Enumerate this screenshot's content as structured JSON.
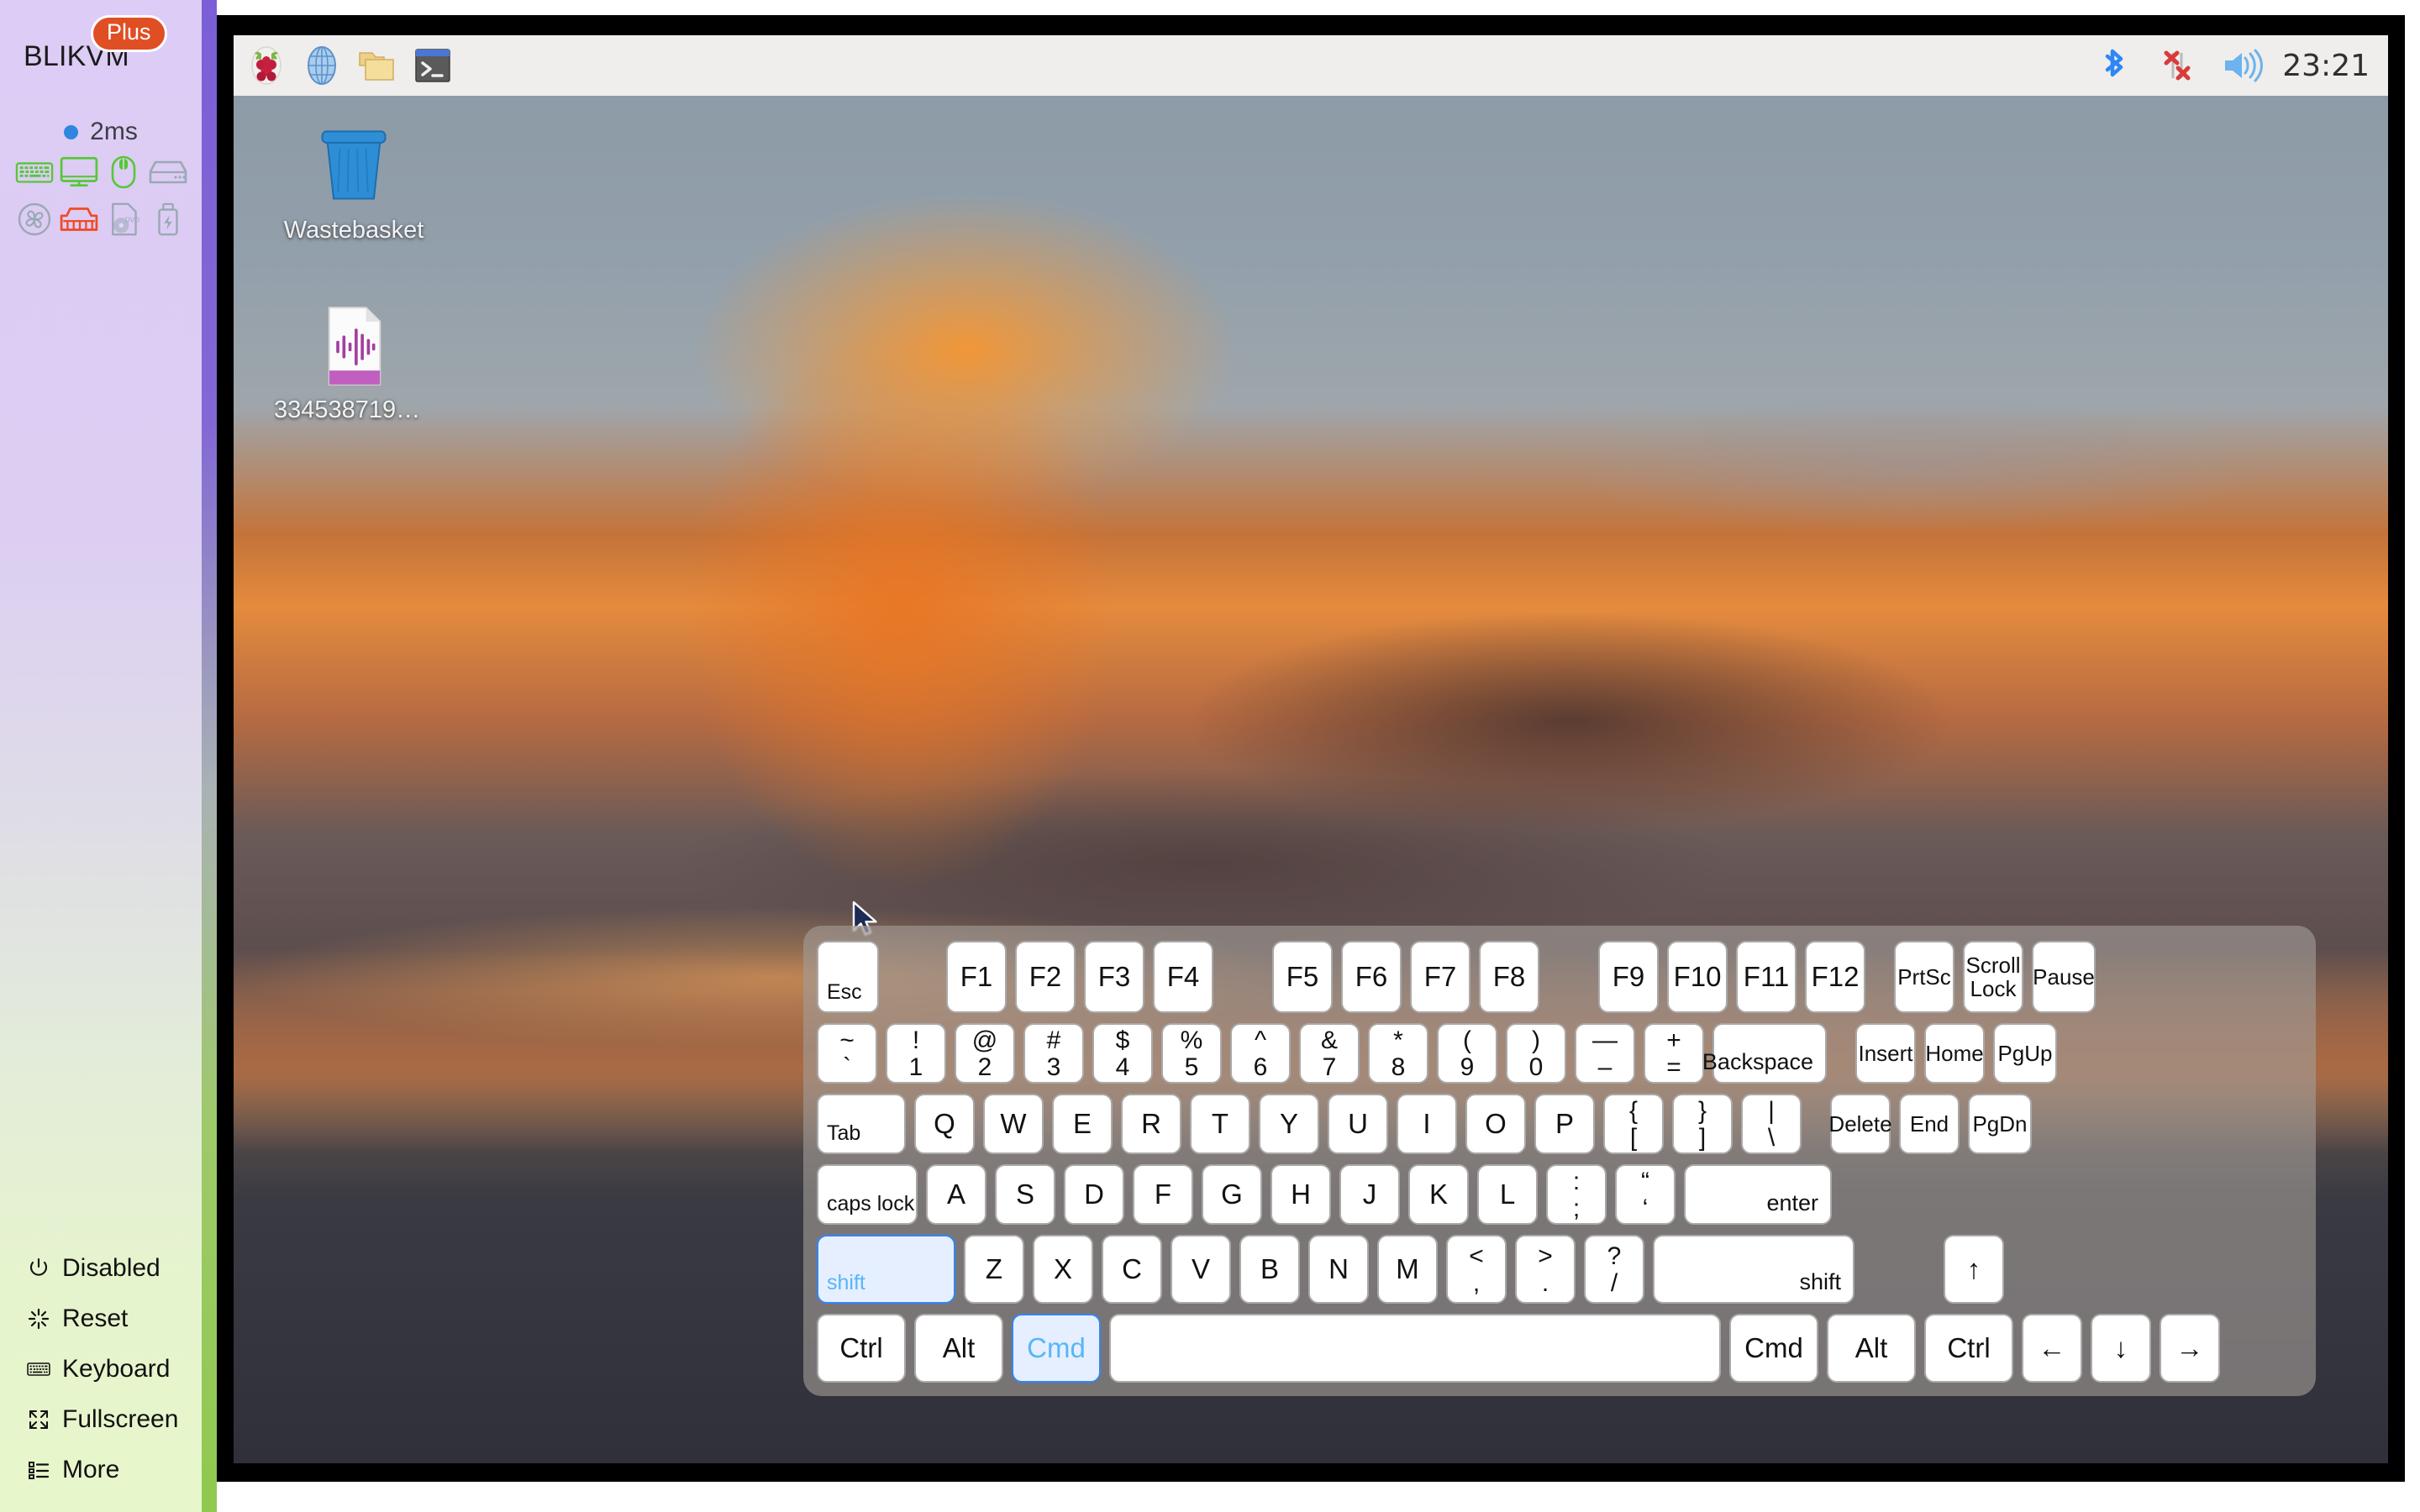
{
  "sidebar": {
    "brand": "BLIKVM",
    "badge": "Plus",
    "latency": "2ms",
    "devices": [
      {
        "name": "keyboard-status-icon",
        "state": "active",
        "color": "#56c736"
      },
      {
        "name": "display-status-icon",
        "state": "active",
        "color": "#56c736"
      },
      {
        "name": "mouse-status-icon",
        "state": "active",
        "color": "#56c736"
      },
      {
        "name": "storage-status-icon",
        "state": "inactive",
        "color": "#9aa9b4"
      },
      {
        "name": "fan-status-icon",
        "state": "inactive",
        "color": "#9aa9b4"
      },
      {
        "name": "ethernet-status-icon",
        "state": "alert",
        "color": "#f04a22"
      },
      {
        "name": "dvd-status-icon",
        "state": "inactive",
        "color": "#9aa9b4"
      },
      {
        "name": "usb-status-icon",
        "state": "inactive",
        "color": "#9aa9b4"
      }
    ],
    "menu": [
      {
        "icon": "power-icon",
        "label": "Disabled"
      },
      {
        "icon": "reset-icon",
        "label": "Reset"
      },
      {
        "icon": "keyboard-icon",
        "label": "Keyboard"
      },
      {
        "icon": "fullscreen-icon",
        "label": "Fullscreen"
      },
      {
        "icon": "more-icon",
        "label": "More"
      }
    ]
  },
  "remote": {
    "taskbar": {
      "launchers": [
        "raspberry-menu-icon",
        "web-browser-icon",
        "file-manager-icon",
        "terminal-icon"
      ],
      "tray": [
        "bluetooth-icon",
        "network-disconnected-icon",
        "volume-icon"
      ],
      "clock": "23:21"
    },
    "desktop_icons": [
      {
        "icon": "wastebasket-icon",
        "label": "Wastebasket"
      },
      {
        "icon": "audio-file-icon",
        "label": "3345387197...."
      }
    ]
  },
  "keyboard": {
    "rows": [
      {
        "id": "function-row",
        "keys": [
          {
            "n": "key-esc",
            "label": "Esc",
            "style": "label-bl",
            "w": "w-esc"
          },
          {
            "n": "gap",
            "type": "gap",
            "px": 60
          },
          {
            "n": "key-f1",
            "label": "F1"
          },
          {
            "n": "key-f2",
            "label": "F2"
          },
          {
            "n": "key-f3",
            "label": "F3"
          },
          {
            "n": "key-f4",
            "label": "F4"
          },
          {
            "n": "gap",
            "type": "gap",
            "px": 50
          },
          {
            "n": "key-f5",
            "label": "F5"
          },
          {
            "n": "key-f6",
            "label": "F6"
          },
          {
            "n": "key-f7",
            "label": "F7"
          },
          {
            "n": "key-f8",
            "label": "F8"
          },
          {
            "n": "gap",
            "type": "gap",
            "px": 50
          },
          {
            "n": "key-f9",
            "label": "F9"
          },
          {
            "n": "key-f10",
            "label": "F10"
          },
          {
            "n": "key-f11",
            "label": "F11"
          },
          {
            "n": "key-f12",
            "label": "F12"
          },
          {
            "n": "gap",
            "type": "gap",
            "px": 14
          },
          {
            "n": "key-prtsc",
            "label": "PrtSc",
            "style": "small"
          },
          {
            "n": "key-scroll-lock",
            "label": "Scroll\nLock",
            "style": "two-line"
          },
          {
            "n": "key-pause",
            "label": "Pause",
            "style": "small",
            "w": "w-pause"
          }
        ]
      },
      {
        "id": "number-row",
        "keys": [
          {
            "n": "key-backtick",
            "top": "~",
            "bot": "`"
          },
          {
            "n": "key-1",
            "top": "!",
            "bot": "1"
          },
          {
            "n": "key-2",
            "top": "@",
            "bot": "2"
          },
          {
            "n": "key-3",
            "top": "#",
            "bot": "3"
          },
          {
            "n": "key-4",
            "top": "$",
            "bot": "4"
          },
          {
            "n": "key-5",
            "top": "%",
            "bot": "5"
          },
          {
            "n": "key-6",
            "top": "^",
            "bot": "6"
          },
          {
            "n": "key-7",
            "top": "&",
            "bot": "7"
          },
          {
            "n": "key-8",
            "top": "*",
            "bot": "8"
          },
          {
            "n": "key-9",
            "top": "(",
            "bot": "9"
          },
          {
            "n": "key-0",
            "top": ")",
            "bot": "0"
          },
          {
            "n": "key-minus",
            "top": "—",
            "bot": "–"
          },
          {
            "n": "key-equals",
            "top": "+",
            "bot": "="
          },
          {
            "n": "key-backspace",
            "label": "Backspace",
            "style": "label-br",
            "w": "w-bksp"
          },
          {
            "n": "gap",
            "type": "gap",
            "px": 14
          },
          {
            "n": "key-insert",
            "label": "Insert",
            "style": "small"
          },
          {
            "n": "key-home",
            "label": "Home",
            "style": "small"
          },
          {
            "n": "key-pgup",
            "label": "PgUp",
            "style": "small",
            "w": "w-pause"
          }
        ]
      },
      {
        "id": "qwerty-row",
        "keys": [
          {
            "n": "key-tab",
            "label": "Tab",
            "style": "label-bl",
            "w": "w-tab"
          },
          {
            "n": "key-q",
            "label": "Q"
          },
          {
            "n": "key-w",
            "label": "W"
          },
          {
            "n": "key-e",
            "label": "E"
          },
          {
            "n": "key-r",
            "label": "R"
          },
          {
            "n": "key-t",
            "label": "T"
          },
          {
            "n": "key-y",
            "label": "Y"
          },
          {
            "n": "key-u",
            "label": "U"
          },
          {
            "n": "key-i",
            "label": "I"
          },
          {
            "n": "key-o",
            "label": "O"
          },
          {
            "n": "key-p",
            "label": "P"
          },
          {
            "n": "key-bracket-left",
            "top": "{",
            "bot": "["
          },
          {
            "n": "key-bracket-right",
            "top": "}",
            "bot": "]"
          },
          {
            "n": "key-backslash",
            "top": "|",
            "bot": "\\"
          },
          {
            "n": "gap",
            "type": "gap",
            "px": 14
          },
          {
            "n": "key-delete",
            "label": "Delete",
            "style": "small"
          },
          {
            "n": "key-end",
            "label": "End",
            "style": "small"
          },
          {
            "n": "key-pgdn",
            "label": "PgDn",
            "style": "small",
            "w": "w-pause"
          }
        ]
      },
      {
        "id": "home-row",
        "keys": [
          {
            "n": "key-caps-lock",
            "label": "caps lock",
            "style": "label-bl",
            "w": "w-caps"
          },
          {
            "n": "key-a",
            "label": "A"
          },
          {
            "n": "key-s",
            "label": "S"
          },
          {
            "n": "key-d",
            "label": "D"
          },
          {
            "n": "key-f",
            "label": "F"
          },
          {
            "n": "key-g",
            "label": "G"
          },
          {
            "n": "key-h",
            "label": "H"
          },
          {
            "n": "key-j",
            "label": "J"
          },
          {
            "n": "key-k",
            "label": "K"
          },
          {
            "n": "key-l",
            "label": "L"
          },
          {
            "n": "key-semicolon",
            "top": ":",
            "bot": ";"
          },
          {
            "n": "key-quote",
            "top": "“",
            "bot": "‘"
          },
          {
            "n": "key-enter",
            "label": "enter",
            "style": "label-br",
            "w": "w-enter"
          }
        ]
      },
      {
        "id": "shift-row",
        "keys": [
          {
            "n": "key-shift-left",
            "label": "shift",
            "style": "label-bl",
            "w": "w-lshift",
            "active": true
          },
          {
            "n": "key-z",
            "label": "Z"
          },
          {
            "n": "key-x",
            "label": "X"
          },
          {
            "n": "key-c",
            "label": "C"
          },
          {
            "n": "key-v",
            "label": "V"
          },
          {
            "n": "key-b",
            "label": "B"
          },
          {
            "n": "key-n",
            "label": "N"
          },
          {
            "n": "key-m",
            "label": "M"
          },
          {
            "n": "key-comma",
            "top": "<",
            "bot": ","
          },
          {
            "n": "key-period",
            "top": ">",
            "bot": "."
          },
          {
            "n": "key-slash",
            "top": "?",
            "bot": "/"
          },
          {
            "n": "key-shift-right",
            "label": "shift",
            "style": "label-br",
            "w": "w-rshift"
          },
          {
            "n": "gap",
            "type": "gap",
            "px": 86
          },
          {
            "n": "key-arrow-up",
            "label": "↑"
          }
        ]
      },
      {
        "id": "bottom-row",
        "keys": [
          {
            "n": "key-ctrl-left",
            "label": "Ctrl",
            "w": "w-tab"
          },
          {
            "n": "key-alt-left",
            "label": "Alt",
            "w": "w-tab"
          },
          {
            "n": "key-cmd-left",
            "label": "Cmd",
            "w": "w-tab",
            "active": true
          },
          {
            "n": "key-space",
            "label": "",
            "w": "w-space"
          },
          {
            "n": "key-cmd-right",
            "label": "Cmd",
            "w": "w-tab"
          },
          {
            "n": "key-alt-right",
            "label": "Alt",
            "w": "w-tab"
          },
          {
            "n": "key-ctrl-right",
            "label": "Ctrl",
            "w": "w-tab"
          },
          {
            "n": "key-arrow-left",
            "label": "←"
          },
          {
            "n": "key-arrow-down",
            "label": "↓"
          },
          {
            "n": "key-arrow-right",
            "label": "→"
          }
        ]
      }
    ]
  }
}
